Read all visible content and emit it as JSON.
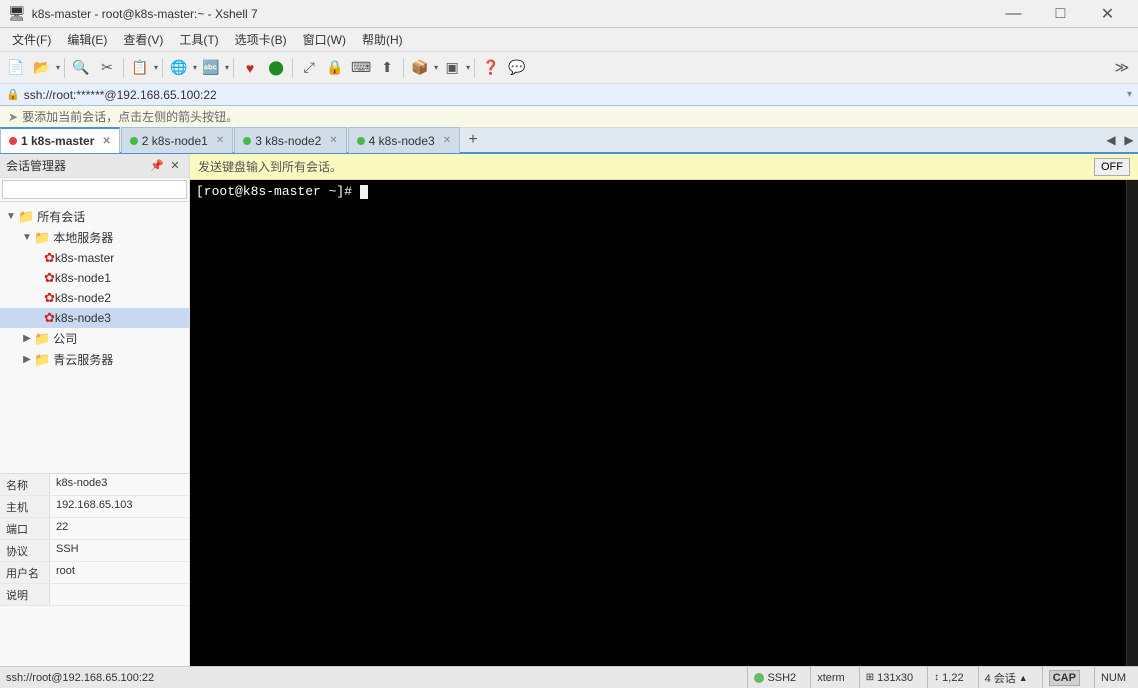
{
  "titlebar": {
    "icon": "xshell-icon",
    "title": "k8s-master - root@k8s-master:~ - Xshell 7",
    "min": "—",
    "max": "□",
    "close": "✕"
  },
  "menubar": {
    "items": [
      "文件(F)",
      "编辑(E)",
      "查看(V)",
      "工具(T)",
      "选项卡(B)",
      "窗口(W)",
      "帮助(H)"
    ]
  },
  "address": {
    "text": "ssh://root:******@192.168.65.100:22"
  },
  "notification": {
    "text": "要添加当前会话，点击左侧的箭头按钮。"
  },
  "tabs": [
    {
      "num": "1",
      "label": "k8s-master",
      "active": true,
      "dot": "red"
    },
    {
      "num": "2",
      "label": "k8s-node1",
      "active": false,
      "dot": "green"
    },
    {
      "num": "3",
      "label": "k8s-node2",
      "active": false,
      "dot": "green"
    },
    {
      "num": "4",
      "label": "k8s-node3",
      "active": false,
      "dot": "green"
    }
  ],
  "sidebar": {
    "title": "会话管理器",
    "tree": [
      {
        "level": 0,
        "type": "folder",
        "label": "所有会话",
        "expanded": true
      },
      {
        "level": 1,
        "type": "folder",
        "label": "本地服务器",
        "expanded": true
      },
      {
        "level": 2,
        "type": "server-red",
        "label": "k8s-master",
        "selected": false
      },
      {
        "level": 2,
        "type": "server-red",
        "label": "k8s-node1",
        "selected": false
      },
      {
        "level": 2,
        "type": "server-red",
        "label": "k8s-node2",
        "selected": false
      },
      {
        "level": 2,
        "type": "server-red",
        "label": "k8s-node3",
        "selected": true
      },
      {
        "level": 1,
        "type": "folder",
        "label": "公司",
        "expanded": false
      },
      {
        "level": 1,
        "type": "folder",
        "label": "青云服务器",
        "expanded": false
      }
    ]
  },
  "info": {
    "name_label": "名称",
    "name_value": "k8s-node3",
    "host_label": "主机",
    "host_value": "192.168.65.103",
    "port_label": "端口",
    "port_value": "22",
    "protocol_label": "协议",
    "protocol_value": "SSH",
    "user_label": "用户名",
    "user_value": "root",
    "desc_label": "说明",
    "desc_value": ""
  },
  "terminal": {
    "prompt": "[root@k8s-master ~]# "
  },
  "send_all": {
    "text": "发送键盘输入到所有会话。",
    "toggle": "OFF"
  },
  "statusbar": {
    "left": "ssh://root@192.168.65.100:22",
    "protocol": "SSH2",
    "terminal": "xterm",
    "size": "131x30",
    "position": "1,22",
    "sessions": "4 会话",
    "cap": "CAP",
    "num": "NUM"
  }
}
